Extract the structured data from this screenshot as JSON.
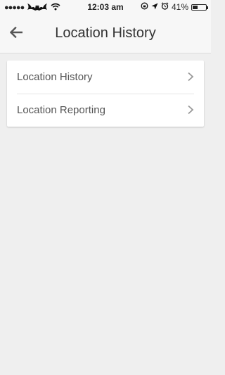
{
  "status_bar": {
    "signal": "●●●●●",
    "carrier_icon": "batman-icon",
    "time": "12:03 am",
    "battery_percent": "41%",
    "battery_level": 0.41
  },
  "header": {
    "title": "Location History",
    "back_icon": "back-arrow-icon"
  },
  "settings": {
    "items": [
      {
        "label": "Location History",
        "icon": "chevron-right-icon"
      },
      {
        "label": "Location Reporting",
        "icon": "chevron-right-icon"
      }
    ]
  }
}
